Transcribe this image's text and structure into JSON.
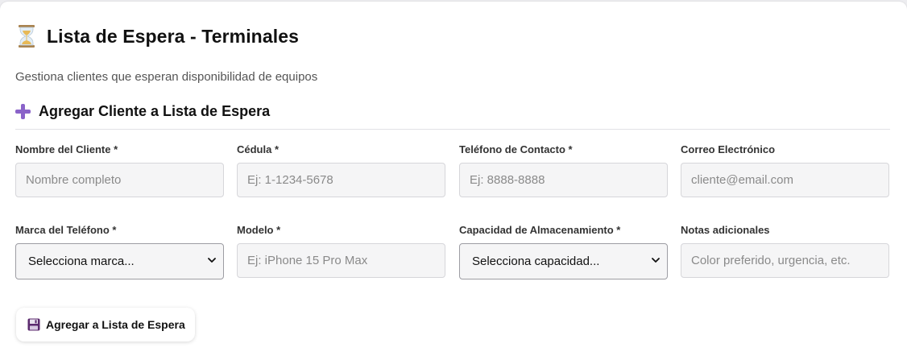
{
  "header": {
    "title": "Lista de Espera - Terminales",
    "subtitle": "Gestiona clientes que esperan disponibilidad de equipos",
    "icon": "hourglass-icon"
  },
  "section": {
    "title": "Agregar Cliente a Lista de Espera",
    "icon": "plus-icon"
  },
  "form": {
    "nombre": {
      "label": "Nombre del Cliente *",
      "placeholder": "Nombre completo",
      "value": ""
    },
    "cedula": {
      "label": "Cédula *",
      "placeholder": "Ej: 1-1234-5678",
      "value": ""
    },
    "telefono": {
      "label": "Teléfono de Contacto *",
      "placeholder": "Ej: 8888-8888",
      "value": ""
    },
    "correo": {
      "label": "Correo Electrónico",
      "placeholder": "cliente@email.com",
      "value": ""
    },
    "marca": {
      "label": "Marca del Teléfono *",
      "selected": "Selecciona marca..."
    },
    "modelo": {
      "label": "Modelo *",
      "placeholder": "Ej: iPhone 15 Pro Max",
      "value": ""
    },
    "capacidad": {
      "label": "Capacidad de Almacenamiento *",
      "selected": "Selecciona capacidad..."
    },
    "notas": {
      "label": "Notas adicionales",
      "placeholder": "Color preferido, urgencia, etc.",
      "value": ""
    }
  },
  "submit": {
    "label": "Agregar a Lista de Espera",
    "icon": "floppy-disk-icon"
  },
  "colors": {
    "accent": "#8a63c9",
    "input_bg": "#f5f5f6",
    "input_border": "#d6d6da"
  }
}
